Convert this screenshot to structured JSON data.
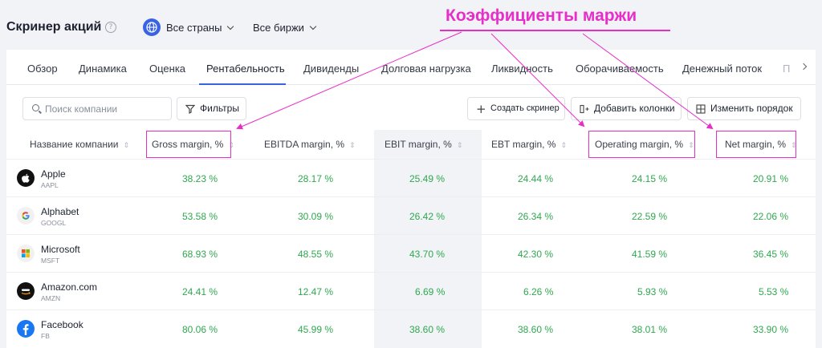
{
  "header": {
    "title": "Скринер акций",
    "help_icon": "?",
    "countries_dropdown": "Все страны",
    "exchanges_dropdown": "Все биржи"
  },
  "annotation": {
    "title": "Коэффициенты маржи",
    "color": "#e62ec9"
  },
  "tabs": [
    {
      "label": "Обзор"
    },
    {
      "label": "Динамика"
    },
    {
      "label": "Оценка"
    },
    {
      "label": "Рентабельность"
    },
    {
      "label": "Дивиденды"
    },
    {
      "label": "Долговая нагрузка"
    },
    {
      "label": "Ликвидность"
    },
    {
      "label": "Оборачиваемость"
    },
    {
      "label": "Денежный поток"
    },
    {
      "label": "П"
    }
  ],
  "active_tab": "Рентабельность",
  "toolbar": {
    "search_placeholder": "Поиск компании",
    "filters_label": "Фильтры",
    "create_screener_label": "Создать скринер",
    "add_columns_label": "Добавить колонки",
    "change_order_label": "Изменить порядок"
  },
  "table": {
    "columns": [
      "Название компании",
      "Gross margin, %",
      "EBITDA margin, %",
      "EBIT margin, %",
      "EBT margin, %",
      "Operating margin, %",
      "Net margin, %"
    ],
    "rows": [
      {
        "name": "Apple",
        "ticker": "AAPL",
        "values": [
          "38.23 %",
          "28.17 %",
          "25.49 %",
          "24.44 %",
          "24.15 %",
          "20.91 %"
        ]
      },
      {
        "name": "Alphabet",
        "ticker": "GOOGL",
        "values": [
          "53.58 %",
          "30.09 %",
          "26.42 %",
          "26.34 %",
          "22.59 %",
          "22.06 %"
        ]
      },
      {
        "name": "Microsoft",
        "ticker": "MSFT",
        "values": [
          "68.93 %",
          "48.55 %",
          "43.70 %",
          "42.30 %",
          "41.59 %",
          "36.45 %"
        ]
      },
      {
        "name": "Amazon.com",
        "ticker": "AMZN",
        "values": [
          "24.41 %",
          "12.47 %",
          "6.69 %",
          "6.26 %",
          "5.93 %",
          "5.53 %"
        ]
      },
      {
        "name": "Facebook",
        "ticker": "FB",
        "values": [
          "80.06 %",
          "45.99 %",
          "38.60 %",
          "38.60 %",
          "38.01 %",
          "33.90 %"
        ]
      }
    ]
  },
  "colors": {
    "accent": "#3a63e3",
    "positive_value": "#2fa84f",
    "annotation": "#e62ec9"
  }
}
